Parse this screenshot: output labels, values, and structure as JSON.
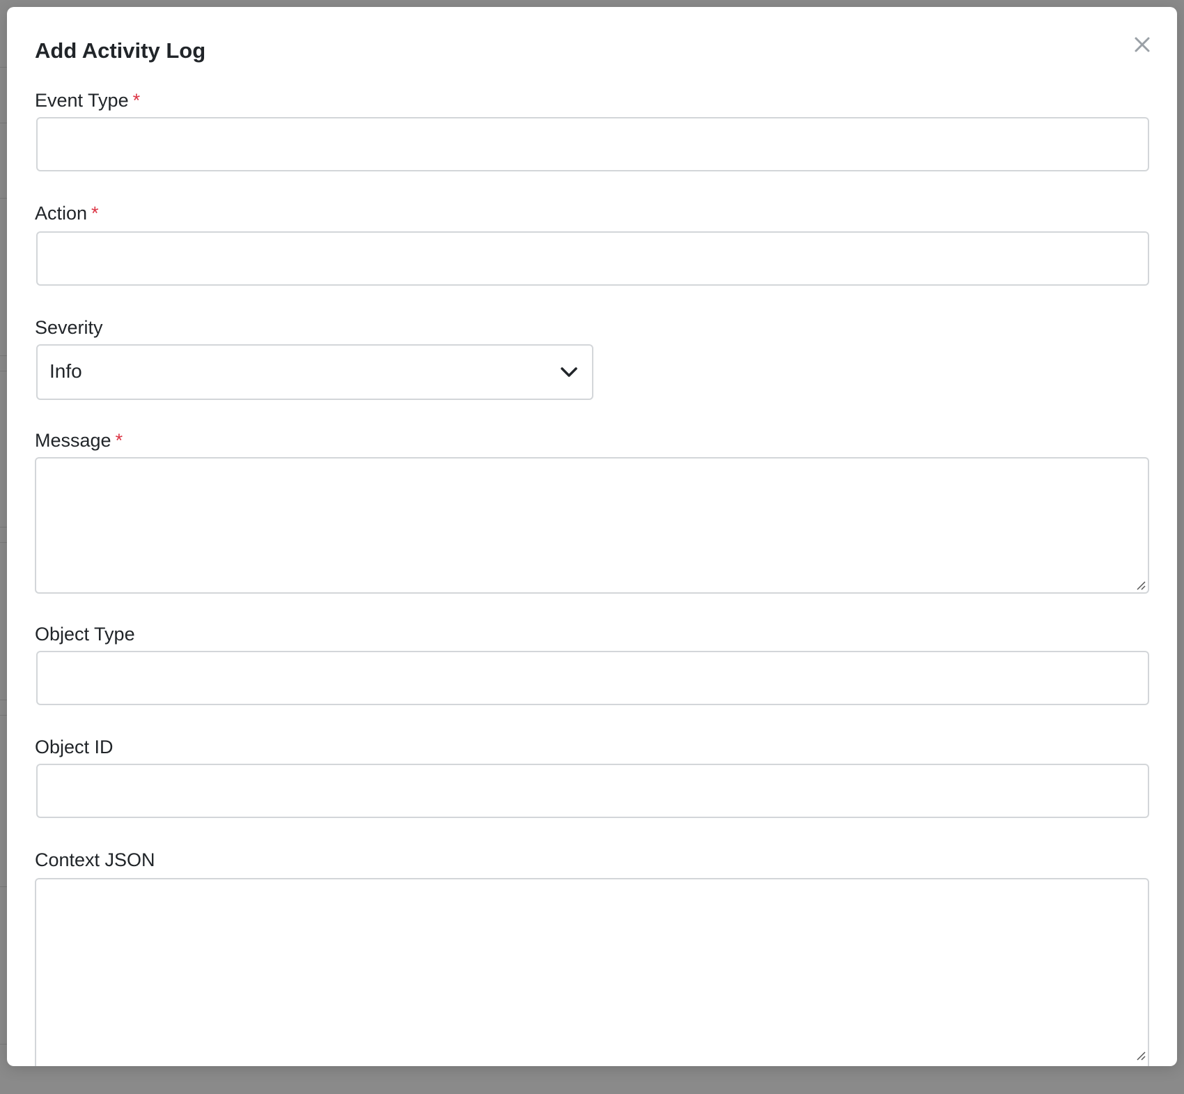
{
  "modal": {
    "title": "Add Activity Log",
    "close_label": "×"
  },
  "form": {
    "required_marker": "*",
    "event_type": {
      "label": "Event Type",
      "value": ""
    },
    "action": {
      "label": "Action",
      "value": ""
    },
    "severity": {
      "label": "Severity",
      "selected": "Info"
    },
    "message": {
      "label": "Message",
      "value": ""
    },
    "object_type": {
      "label": "Object Type",
      "value": ""
    },
    "object_id": {
      "label": "Object ID",
      "value": ""
    },
    "context_json": {
      "label": "Context JSON",
      "value": ""
    }
  },
  "colors": {
    "overlay": "#8a8a8a",
    "required": "#dc3545",
    "border": "#d3d6d9",
    "text": "#212529",
    "close_icon": "#9aa0a6"
  },
  "icons": {
    "close": "close-icon",
    "select": "chevron-down-icon",
    "resize": "resize-grip-icon"
  }
}
